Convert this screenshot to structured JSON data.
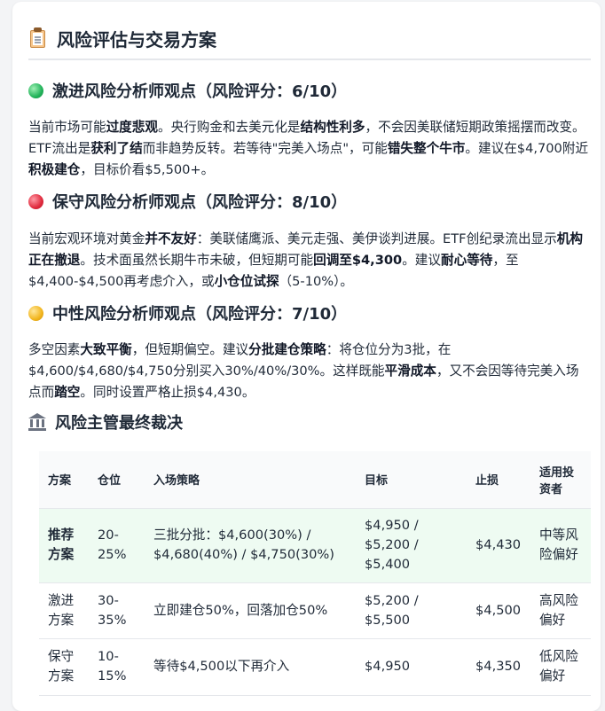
{
  "header": {
    "title": "风险评估与交易方案",
    "icon": "clipboard-icon"
  },
  "sections": [
    {
      "heading": "激进风险分析师观点（风险评分：6/10）",
      "dot_color": "#22b35a",
      "segments": [
        {
          "t": "当前市场可能"
        },
        {
          "t": "过度悲观",
          "b": true
        },
        {
          "t": "。央行购金和去美元化是"
        },
        {
          "t": "结构性利多",
          "b": true
        },
        {
          "t": "，不会因美联储短期政策摇摆而改变。ETF流出是"
        },
        {
          "t": "获利了结",
          "b": true
        },
        {
          "t": "而非趋势反转。若等待\"完美入场点\"，可能"
        },
        {
          "t": "错失整个牛市",
          "b": true
        },
        {
          "t": "。建议在$4,700附近"
        },
        {
          "t": "积极建仓",
          "b": true
        },
        {
          "t": "，目标价看$5,500+。"
        }
      ]
    },
    {
      "heading": "保守风险分析师观点（风险评分：8/10）",
      "dot_color": "#e02a3d",
      "segments": [
        {
          "t": "当前宏观环境对黄金"
        },
        {
          "t": "并不友好",
          "b": true
        },
        {
          "t": "：美联储鹰派、美元走强、美伊谈判进展。ETF创纪录流出显示"
        },
        {
          "t": "机构正在撤退",
          "b": true
        },
        {
          "t": "。技术面虽然长期牛市未破，但短期可能"
        },
        {
          "t": "回调至$4,300",
          "b": true
        },
        {
          "t": "。建议"
        },
        {
          "t": "耐心等待",
          "b": true
        },
        {
          "t": "，至$4,400-$4,500再考虑介入，或"
        },
        {
          "t": "小仓位试探",
          "b": true
        },
        {
          "t": "（5-10%）。"
        }
      ]
    },
    {
      "heading": "中性风险分析师观点（风险评分：7/10）",
      "dot_color": "#f2b51d",
      "segments": [
        {
          "t": "多空因素"
        },
        {
          "t": "大致平衡",
          "b": true
        },
        {
          "t": "，但短期偏空。建议"
        },
        {
          "t": "分批建仓策略",
          "b": true
        },
        {
          "t": "：将仓位分为3批，在$4,600/$4,680/$4,750分别买入30%/40%/30%。这样既能"
        },
        {
          "t": "平滑成本",
          "b": true
        },
        {
          "t": "，又不会因等待完美入场点而"
        },
        {
          "t": "踏空",
          "b": true
        },
        {
          "t": "。同时设置严格止损$4,430。"
        }
      ]
    }
  ],
  "verdict": {
    "heading": "风险主管最终裁决",
    "icon": "bank-icon"
  },
  "table": {
    "headers": [
      "方案",
      "仓位",
      "入场策略",
      "目标",
      "止损",
      "适用投资者"
    ],
    "rows": [
      [
        "推荐方案",
        "20-25%",
        "三批分批：$4,600(30%) / $4,680(40%) / $4,750(30%)",
        "$4,950 / $5,200 / $5,400",
        "$4,430",
        "中等风险偏好"
      ],
      [
        "激进方案",
        "30-35%",
        "立即建仓50%，回落加仓50%",
        "$5,200 / $5,500",
        "$4,500",
        "高风险偏好"
      ],
      [
        "保守方案",
        "10-15%",
        "等待$4,500以下再介入",
        "$4,950",
        "$4,350",
        "低风险偏好"
      ]
    ]
  }
}
